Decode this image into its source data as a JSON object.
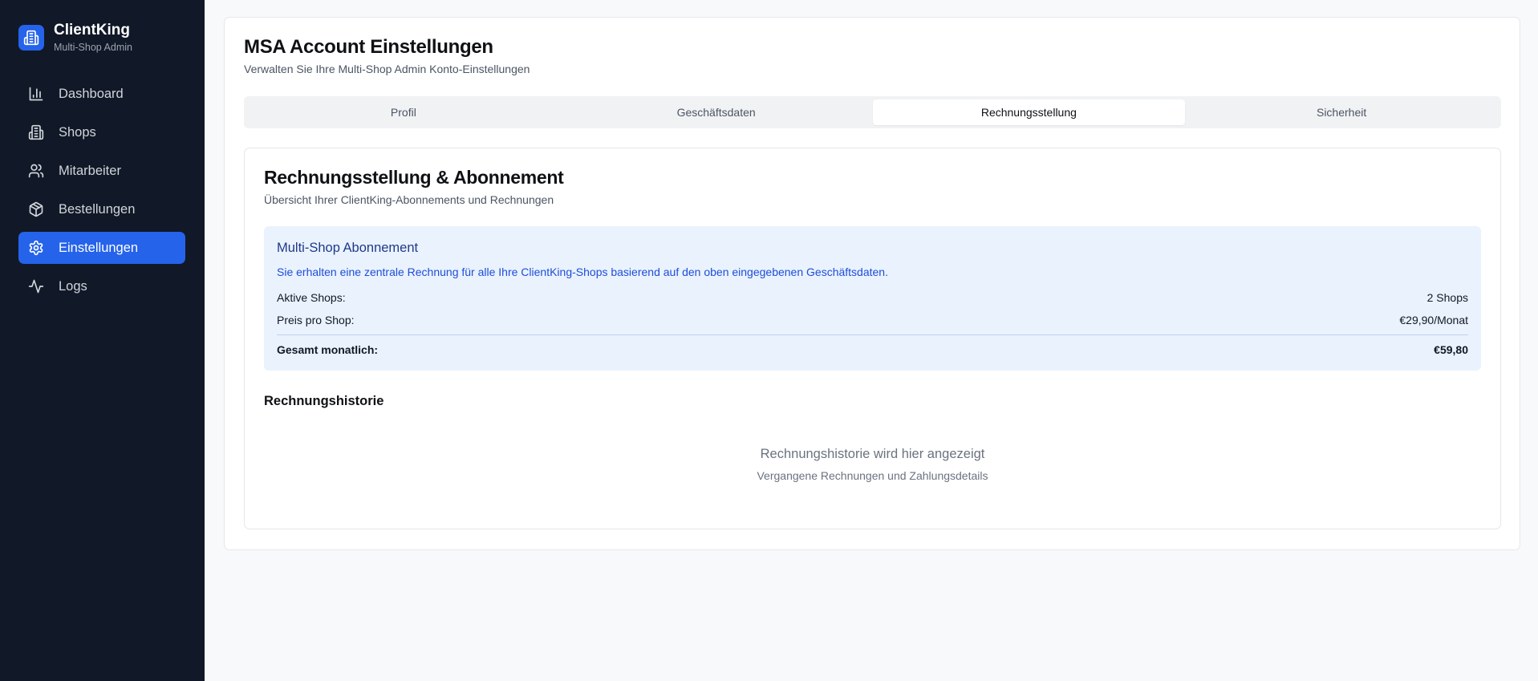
{
  "sidebar": {
    "brand_name": "ClientKing",
    "brand_sub": "Multi-Shop Admin",
    "items": [
      {
        "label": "Dashboard",
        "icon": "bar-chart-icon"
      },
      {
        "label": "Shops",
        "icon": "building-icon"
      },
      {
        "label": "Mitarbeiter",
        "icon": "users-icon"
      },
      {
        "label": "Bestellungen",
        "icon": "package-icon"
      },
      {
        "label": "Einstellungen",
        "icon": "gear-icon",
        "active": true
      },
      {
        "label": "Logs",
        "icon": "activity-icon"
      }
    ]
  },
  "page": {
    "title": "MSA Account Einstellungen",
    "subtitle": "Verwalten Sie Ihre Multi-Shop Admin Konto-Einstellungen"
  },
  "tabs": [
    {
      "label": "Profil"
    },
    {
      "label": "Geschäftsdaten"
    },
    {
      "label": "Rechnungsstellung",
      "active": true
    },
    {
      "label": "Sicherheit"
    }
  ],
  "billing": {
    "title": "Rechnungsstellung & Abonnement",
    "subtitle": "Übersicht Ihrer ClientKing-Abonnements und Rechnungen",
    "subscription": {
      "title": "Multi-Shop Abonnement",
      "description": "Sie erhalten eine zentrale Rechnung für alle Ihre ClientKing-Shops basierend auf den oben eingegebenen Geschäftsdaten.",
      "active_shops_label": "Aktive Shops:",
      "active_shops_value": "2 Shops",
      "price_label": "Preis pro Shop:",
      "price_value": "€29,90/Monat",
      "total_label": "Gesamt monatlich:",
      "total_value": "€59,80"
    },
    "history": {
      "title": "Rechnungshistorie",
      "empty_title": "Rechnungshistorie wird hier angezeigt",
      "empty_sub": "Vergangene Rechnungen und Zahlungsdetails"
    }
  },
  "colors": {
    "sidebar_bg": "#111827",
    "accent": "#2563eb",
    "subscription_bg": "#eaf2fe"
  }
}
